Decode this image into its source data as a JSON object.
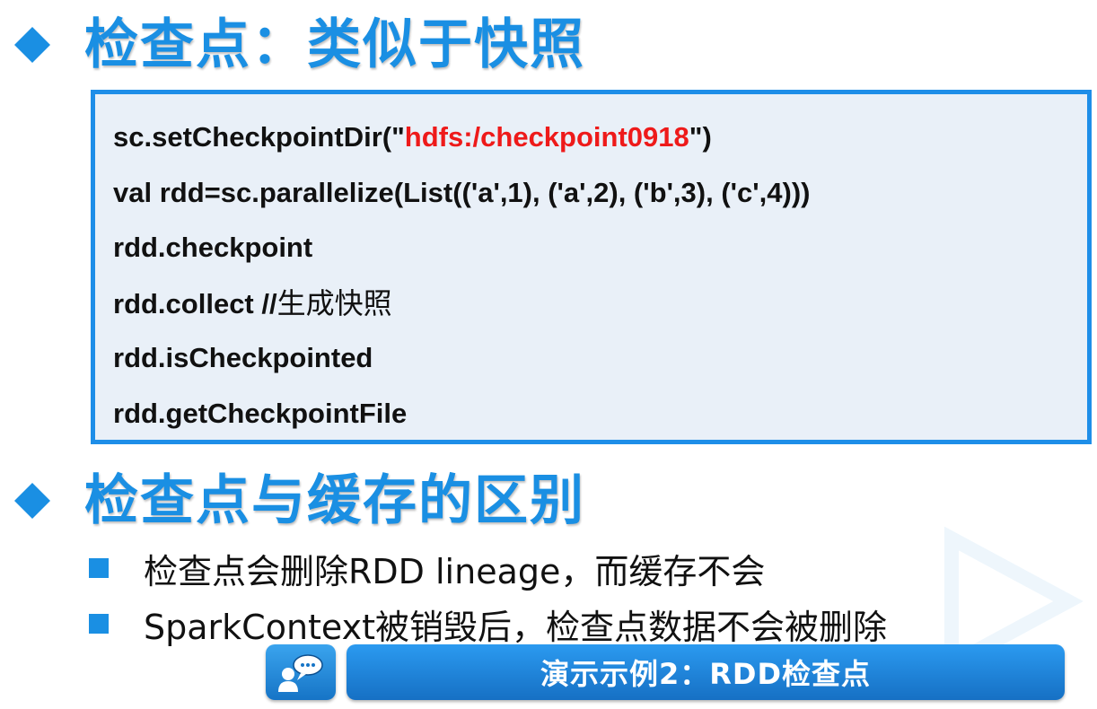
{
  "section1": {
    "title": "检查点：类似于快照"
  },
  "code": {
    "line1_prefix": "sc.setCheckpointDir(\"",
    "line1_path": "hdfs:/checkpoint0918",
    "line1_suffix": "\")",
    "line2": "val rdd=sc.parallelize(List(('a',1), ('a',2), ('b',3), ('c',4)))",
    "line3": "rdd.checkpoint",
    "line4_code": "rdd.collect //",
    "line4_comment": "生成快照",
    "line5": "rdd.isCheckpointed",
    "line6": "rdd.getCheckpointFile"
  },
  "section2": {
    "title": "检查点与缓存的区别",
    "bullets": [
      "检查点会删除RDD lineage，而缓存不会",
      "SparkContext被销毁后，检查点数据不会被删除"
    ]
  },
  "demo": {
    "icon": "chat-person-icon",
    "label": "演示示例2：RDD检查点"
  },
  "colors": {
    "accent": "#1a8fe3",
    "highlight": "#ee1a1a",
    "code_bg": "#e9f0f8"
  }
}
